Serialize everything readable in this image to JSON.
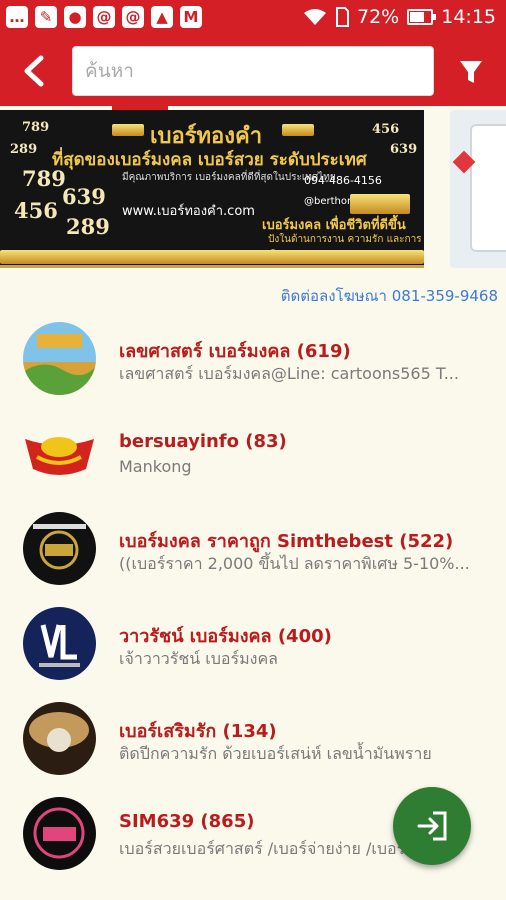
{
  "status_bar": {
    "battery": "72%",
    "time": "14:15",
    "left_icons": [
      "message-icon",
      "notification-icon",
      "keyhole-icon",
      "mail-at-icon",
      "mail-at-icon",
      "image-icon",
      "gmail-icon"
    ]
  },
  "header": {
    "search_placeholder": "ค้นหา"
  },
  "banner": {
    "title": "เบอร์ทองคำ",
    "subtitle": "ที่สุดของเบอร์มงคล เบอร์สวย ระดับประเทศ",
    "numbers_left": [
      "789",
      "289",
      "789",
      "639",
      "456",
      "289"
    ],
    "numbers_right": [
      "456",
      "639"
    ],
    "website": "www.เบอร์ทองคำ.com",
    "phone": "094-486-4156",
    "line": "@berthongkam",
    "slogan": "เบอร์มงคล เพื่อชีวิตที่ดีขึ้น",
    "slogan2": "ปังในด้านการงาน ความรัก และการเงิน",
    "small_text": "มีคุณภาพบริการ เบอร์มงคลที่ดีที่สุดในประเทศไทย"
  },
  "ad_contact": "ติดต่อลงโฆษณา 081-359-9468",
  "items": [
    {
      "title": "เลขศาสตร์ เบอร์มงคล (619)",
      "subtitle": "เลขศาสตร์ เบอร์มงคล@Line:   cartoons565 T...",
      "avatar": "landscape"
    },
    {
      "title": "bersuayinfo (83)",
      "subtitle": "Mankong",
      "avatar": "gold-ingot"
    },
    {
      "title": "เบอร์มงคล ราคาถูก Simthebest (522)",
      "subtitle": "((เบอร์ราคา 2,000 ขึ้นไป ลดราคาพิเศษ 5-10%...",
      "avatar": "sim-logo"
    },
    {
      "title": "วาวรัชน์ เบอร์มงคล (400)",
      "subtitle": "เจ้าวาวรัชน์ เบอร์มงคล",
      "avatar": "lv-logo"
    },
    {
      "title": "เบอร์เสริมรัก (134)",
      "subtitle": "ติดปีกความรัก ด้วยเบอร์เสน่ห์ เลขน้ำมันพราย",
      "avatar": "crystal-ball"
    },
    {
      "title": "SIM639 (865)",
      "subtitle": "เบอร์สวยเบอร์ศาสตร์ /เบอร์จ่ายง่าย /เบอร์...",
      "avatar": "sim639"
    }
  ],
  "colors": {
    "primary": "#d41f26",
    "title_red": "#b91c1c",
    "fab_green": "#2e7d32",
    "background": "#fbf8ec",
    "link_blue": "#3d7bd6"
  }
}
